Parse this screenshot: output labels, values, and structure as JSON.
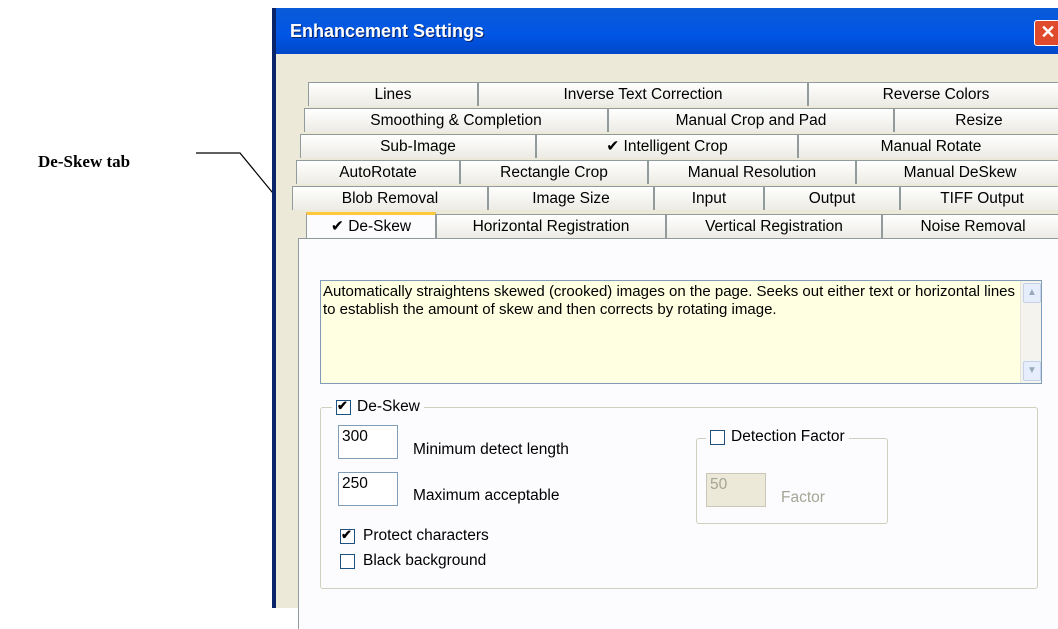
{
  "callout": {
    "label": "De-Skew tab"
  },
  "window": {
    "title": "Enhancement Settings",
    "close_glyph": "✕"
  },
  "tabs": {
    "row1": [
      "Lines",
      "Inverse Text Correction",
      "Reverse Colors"
    ],
    "row2": [
      "Smoothing & Completion",
      "Manual Crop and Pad",
      "Resize"
    ],
    "row3": [
      "Sub-Image",
      "✔  Intelligent Crop",
      "Manual Rotate"
    ],
    "row4": [
      "AutoRotate",
      "Rectangle Crop",
      "Manual Resolution",
      "Manual DeSkew"
    ],
    "row5": [
      "Blob Removal",
      "Image Size",
      "Input",
      "Output",
      "TIFF Output"
    ],
    "row6": [
      "✔  De-Skew",
      "Horizontal Registration",
      "Vertical Registration",
      "Noise Removal"
    ]
  },
  "description": "Automatically straightens skewed (crooked) images on the page. Seeks out either text or horizontal lines to establish the amount of skew and then corrects by rotating image.",
  "deskew_group": {
    "label": "De-Skew",
    "checked": true,
    "min_detect_value": "300",
    "min_detect_label": "Minimum detect length",
    "max_accept_value": "250",
    "max_accept_label": "Maximum acceptable",
    "protect_label": "Protect characters",
    "protect_checked": true,
    "black_bg_label": "Black background",
    "black_bg_checked": false
  },
  "detection_group": {
    "label": "Detection Factor",
    "checked": false,
    "factor_value": "50",
    "factor_label": "Factor"
  }
}
